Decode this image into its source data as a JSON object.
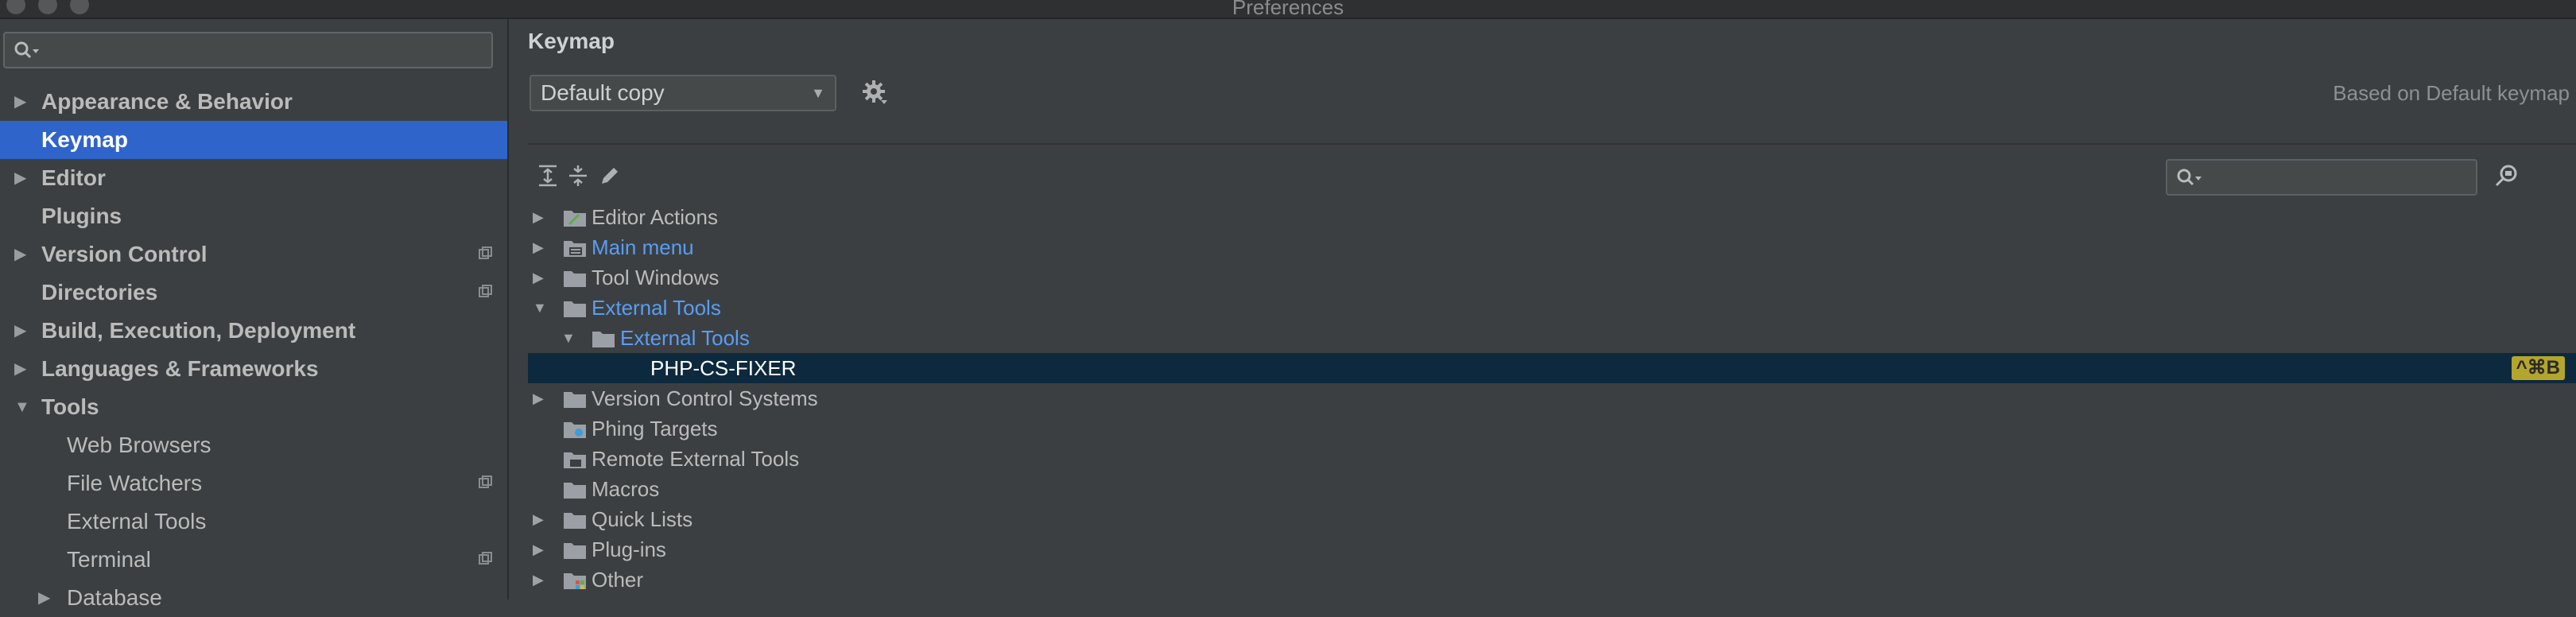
{
  "window": {
    "title": "Preferences"
  },
  "sidebar": {
    "search": {
      "value": "",
      "placeholder": ""
    },
    "items": [
      {
        "label": "Appearance & Behavior",
        "expandable": true,
        "expanded": false,
        "bold": true
      },
      {
        "label": "Keymap",
        "expandable": false,
        "bold": true,
        "selected": true
      },
      {
        "label": "Editor",
        "expandable": true,
        "expanded": false,
        "bold": true
      },
      {
        "label": "Plugins",
        "expandable": false,
        "bold": true
      },
      {
        "label": "Version Control",
        "expandable": true,
        "expanded": false,
        "bold": true,
        "project_icon": true
      },
      {
        "label": "Directories",
        "expandable": false,
        "bold": true,
        "project_icon": true
      },
      {
        "label": "Build, Execution, Deployment",
        "expandable": true,
        "expanded": false,
        "bold": true
      },
      {
        "label": "Languages & Frameworks",
        "expandable": true,
        "expanded": false,
        "bold": true
      },
      {
        "label": "Tools",
        "expandable": true,
        "expanded": true,
        "bold": true
      },
      {
        "label": "Web Browsers",
        "sub": true
      },
      {
        "label": "File Watchers",
        "sub": true,
        "project_icon": true
      },
      {
        "label": "External Tools",
        "sub": true
      },
      {
        "label": "Terminal",
        "sub": true,
        "project_icon": true
      },
      {
        "label": "Database",
        "sub": true,
        "expandable": true,
        "expanded": false
      }
    ]
  },
  "main": {
    "title": "Keymap",
    "keymap_select": {
      "value": "Default copy"
    },
    "based_on": "Based on Default keymap",
    "tree_search": {
      "value": ""
    },
    "tree": [
      {
        "label": "Editor Actions",
        "depth": 0,
        "toggle": "collapsed",
        "icon": "editor-actions-folder-icon"
      },
      {
        "label": "Main menu",
        "depth": 0,
        "toggle": "collapsed",
        "icon": "menu-folder-icon",
        "highlight": true
      },
      {
        "label": "Tool Windows",
        "depth": 0,
        "toggle": "collapsed",
        "icon": "folder-icon"
      },
      {
        "label": "External Tools",
        "depth": 0,
        "toggle": "expanded",
        "icon": "folder-icon",
        "highlight": true
      },
      {
        "label": "External Tools",
        "depth": 1,
        "toggle": "expanded",
        "icon": "folder-icon",
        "highlight": true
      },
      {
        "label": "PHP-CS-FIXER",
        "depth": 2,
        "toggle": "none",
        "selected": true,
        "shortcut": "^⌘B"
      },
      {
        "label": "Version Control Systems",
        "depth": 0,
        "toggle": "collapsed",
        "icon": "folder-icon"
      },
      {
        "label": "Phing Targets",
        "depth": 0,
        "toggle": "none",
        "icon": "phing-folder-icon"
      },
      {
        "label": "Remote External Tools",
        "depth": 0,
        "toggle": "none",
        "icon": "remote-folder-icon"
      },
      {
        "label": "Macros",
        "depth": 0,
        "toggle": "none",
        "icon": "folder-icon"
      },
      {
        "label": "Quick Lists",
        "depth": 0,
        "toggle": "collapsed",
        "icon": "folder-icon"
      },
      {
        "label": "Plug-ins",
        "depth": 0,
        "toggle": "collapsed",
        "icon": "folder-icon"
      },
      {
        "label": "Other",
        "depth": 0,
        "toggle": "collapsed",
        "icon": "other-folder-icon"
      }
    ]
  },
  "colors": {
    "background": "#3c3f41",
    "selection_sidebar": "#2f65ca",
    "selection_tree": "#0d293e",
    "link_blue": "#589df6",
    "shortcut_badge": "#b4a52c"
  }
}
